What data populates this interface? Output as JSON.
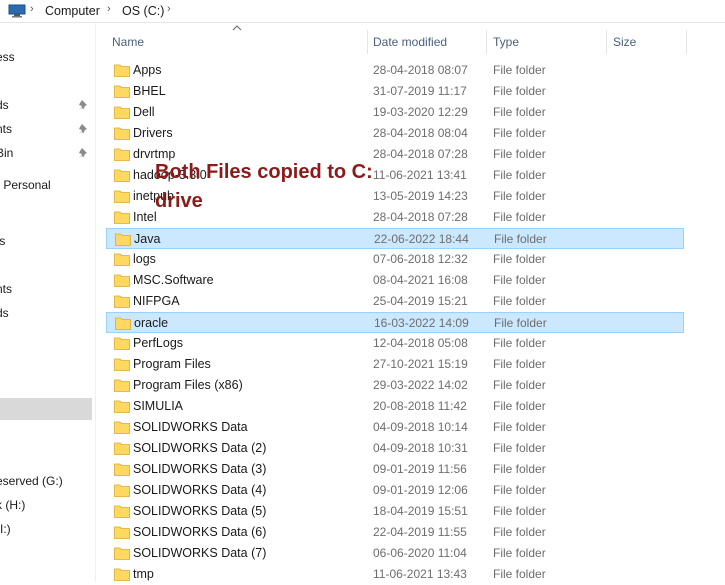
{
  "address": {
    "crumbs": [
      "Computer",
      "OS (C:)"
    ]
  },
  "nav": {
    "items": [
      {
        "label": "ess",
        "pinned": false
      },
      {
        "label": "ds",
        "pinned": true
      },
      {
        "label": "nts",
        "pinned": true
      },
      {
        "label": "Bin",
        "pinned": true
      },
      {
        "label": "- Personal",
        "pinned": false
      },
      {
        "label": "ts",
        "pinned": false
      },
      {
        "label": "nts",
        "pinned": false
      },
      {
        "label": "ds",
        "pinned": false
      },
      {
        "label": ")",
        "pinned": false
      },
      {
        "label": ")",
        "pinned": false
      },
      {
        "label": "eserved (G:)",
        "pinned": false
      },
      {
        "label": "k (H:)",
        "pinned": false
      },
      {
        "label": "(I:)",
        "pinned": false
      }
    ]
  },
  "columns": {
    "name": "Name",
    "date": "Date modified",
    "type": "Type",
    "size": "Size"
  },
  "files": [
    {
      "name": "Apps",
      "date": "28-04-2018 08:07",
      "type": "File folder"
    },
    {
      "name": "BHEL",
      "date": "31-07-2019 11:17",
      "type": "File folder"
    },
    {
      "name": "Dell",
      "date": "19-03-2020 12:29",
      "type": "File folder"
    },
    {
      "name": "Drivers",
      "date": "28-04-2018 08:04",
      "type": "File folder"
    },
    {
      "name": "drvrtmp",
      "date": "28-04-2018 07:28",
      "type": "File folder"
    },
    {
      "name": "hadoop-3.3.0",
      "date": "11-06-2021 13:41",
      "type": "File folder"
    },
    {
      "name": "inetpub",
      "date": "13-05-2019 14:23",
      "type": "File folder"
    },
    {
      "name": "Intel",
      "date": "28-04-2018 07:28",
      "type": "File folder"
    },
    {
      "name": "Java",
      "date": "22-06-2022 18:44",
      "type": "File folder"
    },
    {
      "name": "logs",
      "date": "07-06-2018 12:32",
      "type": "File folder"
    },
    {
      "name": "MSC.Software",
      "date": "08-04-2021 16:08",
      "type": "File folder"
    },
    {
      "name": "NIFPGA",
      "date": "25-04-2019 15:21",
      "type": "File folder"
    },
    {
      "name": "oracle",
      "date": "16-03-2022 14:09",
      "type": "File folder"
    },
    {
      "name": "PerfLogs",
      "date": "12-04-2018 05:08",
      "type": "File folder"
    },
    {
      "name": "Program Files",
      "date": "27-10-2021 15:19",
      "type": "File folder"
    },
    {
      "name": "Program Files (x86)",
      "date": "29-03-2022 14:02",
      "type": "File folder"
    },
    {
      "name": "SIMULIA",
      "date": "20-08-2018 11:42",
      "type": "File folder"
    },
    {
      "name": "SOLIDWORKS Data",
      "date": "04-09-2018 10:14",
      "type": "File folder"
    },
    {
      "name": "SOLIDWORKS Data (2)",
      "date": "04-09-2018 10:31",
      "type": "File folder"
    },
    {
      "name": "SOLIDWORKS Data (3)",
      "date": "09-01-2019 11:56",
      "type": "File folder"
    },
    {
      "name": "SOLIDWORKS Data (4)",
      "date": "09-01-2019 12:06",
      "type": "File folder"
    },
    {
      "name": "SOLIDWORKS Data (5)",
      "date": "18-04-2019 15:51",
      "type": "File folder"
    },
    {
      "name": "SOLIDWORKS Data (6)",
      "date": "22-04-2019 11:55",
      "type": "File folder"
    },
    {
      "name": "SOLIDWORKS Data (7)",
      "date": "06-06-2020 11:04",
      "type": "File folder"
    },
    {
      "name": "tmp",
      "date": "11-06-2021 13:43",
      "type": "File folder"
    }
  ],
  "highlighted_files": [
    "Java",
    "oracle"
  ],
  "annotation": "Both Files copied to C: drive",
  "colors": {
    "folder": "#ffd862",
    "annotation": "#8b1a1a",
    "highlight": "#cce8ff"
  }
}
